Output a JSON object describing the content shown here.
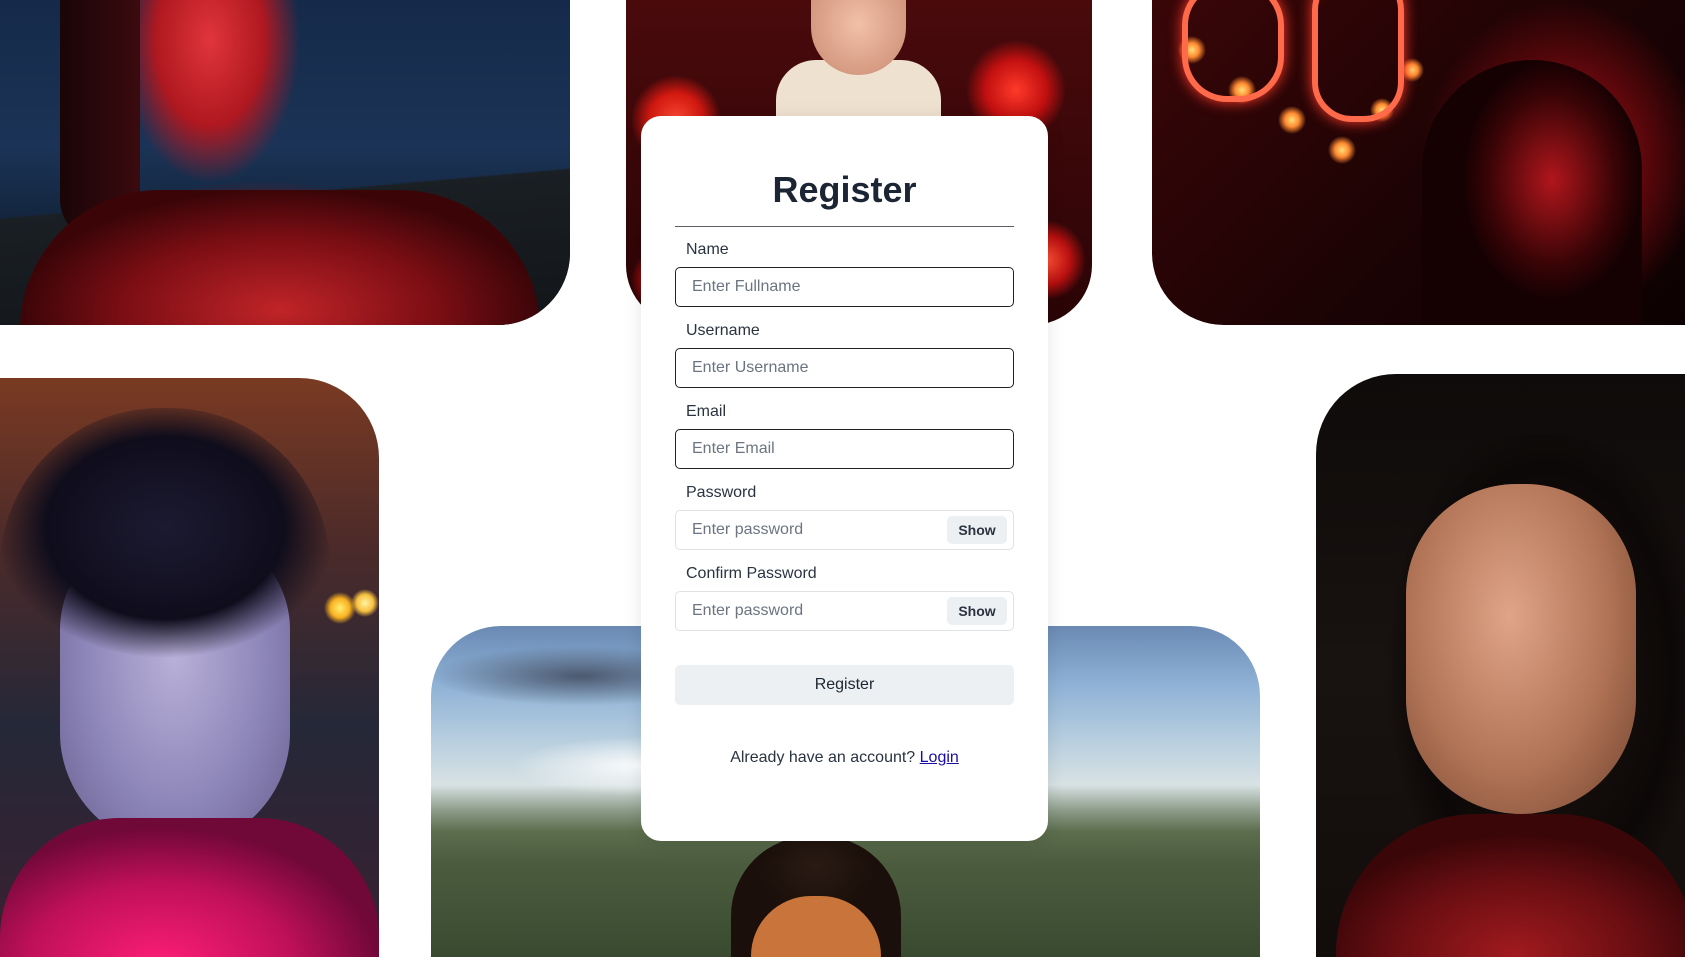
{
  "page": {
    "title": "Register"
  },
  "form": {
    "fields": [
      {
        "label": "Name",
        "placeholder": "Enter Fullname",
        "value": ""
      },
      {
        "label": "Username",
        "placeholder": "Enter Username",
        "value": ""
      },
      {
        "label": "Email",
        "placeholder": "Enter Email",
        "value": ""
      },
      {
        "label": "Password",
        "placeholder": "Enter password",
        "value": "",
        "toggle_label": "Show"
      },
      {
        "label": "Confirm Password",
        "placeholder": "Enter password",
        "value": "",
        "toggle_label": "Show"
      }
    ],
    "submit_label": "Register",
    "login_prompt": "Already have an account?",
    "login_link": "Login"
  },
  "colors": {
    "card_background": "#ffffff",
    "button_background": "#edf0f2",
    "link": "#1a0dab",
    "title": "#1b2533"
  }
}
